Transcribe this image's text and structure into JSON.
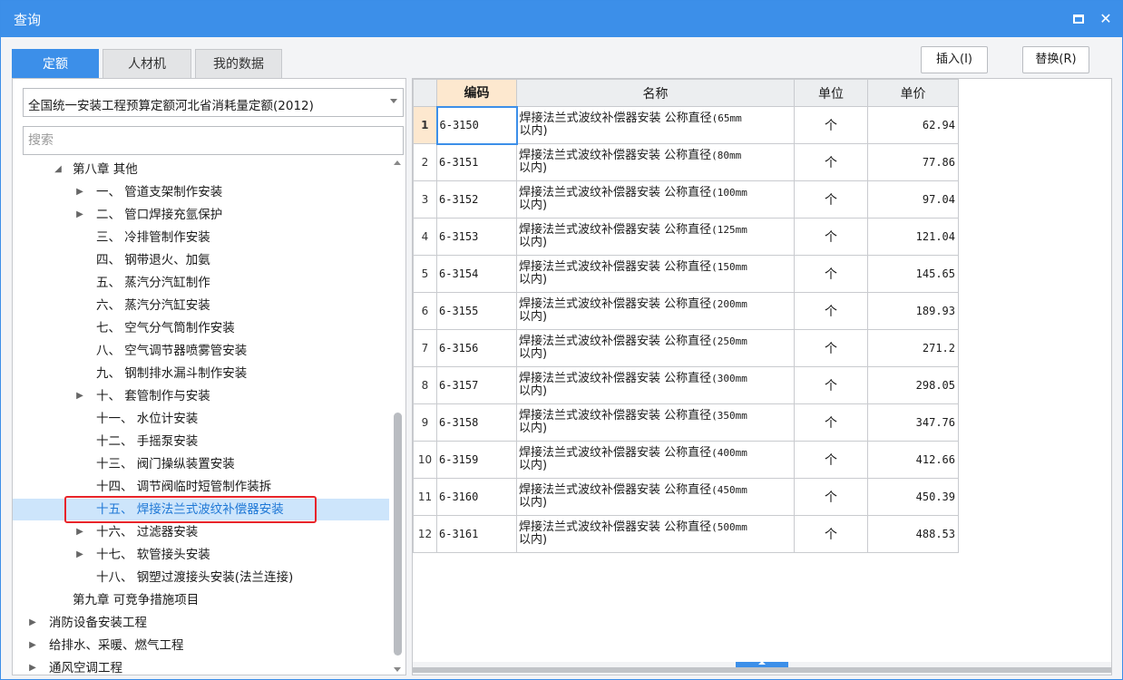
{
  "window": {
    "title": "查询",
    "close": "✕"
  },
  "tabs": [
    {
      "label": "定额",
      "active": true
    },
    {
      "label": "人材机",
      "active": false
    },
    {
      "label": "我的数据",
      "active": false
    }
  ],
  "actions": {
    "insert": "插入(I)",
    "replace": "替换(R)"
  },
  "library_select": {
    "value": "全国统一安装工程预算定额河北省消耗量定额(2012)"
  },
  "search": {
    "placeholder": "搜索"
  },
  "tree": [
    {
      "label": "第八章 其他",
      "toggle": "◢",
      "level": 1
    },
    {
      "label": "一、 管道支架制作安装",
      "toggle": "▶",
      "level": 2
    },
    {
      "label": "二、 管口焊接充氩保护",
      "toggle": "▶",
      "level": 2
    },
    {
      "label": "三、 冷排管制作安装",
      "toggle": "",
      "level": 2
    },
    {
      "label": "四、 钢带退火、加氨",
      "toggle": "",
      "level": 2
    },
    {
      "label": "五、 蒸汽分汽缸制作",
      "toggle": "",
      "level": 2
    },
    {
      "label": "六、 蒸汽分汽缸安装",
      "toggle": "",
      "level": 2
    },
    {
      "label": "七、 空气分气筒制作安装",
      "toggle": "",
      "level": 2
    },
    {
      "label": "八、 空气调节器喷雾管安装",
      "toggle": "",
      "level": 2
    },
    {
      "label": "九、 钢制排水漏斗制作安装",
      "toggle": "",
      "level": 2
    },
    {
      "label": "十、 套管制作与安装",
      "toggle": "▶",
      "level": 2
    },
    {
      "label": "十一、 水位计安装",
      "toggle": "",
      "level": 2
    },
    {
      "label": "十二、 手摇泵安装",
      "toggle": "",
      "level": 2
    },
    {
      "label": "十三、 阀门操纵装置安装",
      "toggle": "",
      "level": 2
    },
    {
      "label": "十四、 调节阀临时短管制作装拆",
      "toggle": "",
      "level": 2
    },
    {
      "label": "十五、 焊接法兰式波纹补偿器安装",
      "toggle": "",
      "level": 2,
      "selected": true
    },
    {
      "label": "十六、 过滤器安装",
      "toggle": "▶",
      "level": 2
    },
    {
      "label": "十七、 软管接头安装",
      "toggle": "▶",
      "level": 2
    },
    {
      "label": "十八、 钢塑过渡接头安装(法兰连接)",
      "toggle": "",
      "level": 2
    },
    {
      "label": "第九章 可竞争措施项目",
      "toggle": "",
      "level": 1
    },
    {
      "label": "消防设备安装工程",
      "toggle": "▶",
      "level": 0
    },
    {
      "label": "给排水、采暖、燃气工程",
      "toggle": "▶",
      "level": 0
    },
    {
      "label": "通风空调工程",
      "toggle": "▶",
      "level": 0
    }
  ],
  "grid": {
    "headers": {
      "code": "编码",
      "name": "名称",
      "unit": "单位",
      "price": "单价"
    },
    "rows": [
      {
        "no": "1",
        "code": "6-3150",
        "name_a": "焊接法兰式波纹补偿器安装 公称直径",
        "name_b": "(65mm",
        "name_c": "以内)",
        "unit": "个",
        "price": "62.94"
      },
      {
        "no": "2",
        "code": "6-3151",
        "name_a": "焊接法兰式波纹补偿器安装 公称直径",
        "name_b": "(80mm",
        "name_c": "以内)",
        "unit": "个",
        "price": "77.86"
      },
      {
        "no": "3",
        "code": "6-3152",
        "name_a": "焊接法兰式波纹补偿器安装 公称直径",
        "name_b": "(100mm",
        "name_c": "以内)",
        "unit": "个",
        "price": "97.04"
      },
      {
        "no": "4",
        "code": "6-3153",
        "name_a": "焊接法兰式波纹补偿器安装 公称直径",
        "name_b": "(125mm",
        "name_c": "以内)",
        "unit": "个",
        "price": "121.04"
      },
      {
        "no": "5",
        "code": "6-3154",
        "name_a": "焊接法兰式波纹补偿器安装 公称直径",
        "name_b": "(150mm",
        "name_c": "以内)",
        "unit": "个",
        "price": "145.65"
      },
      {
        "no": "6",
        "code": "6-3155",
        "name_a": "焊接法兰式波纹补偿器安装 公称直径",
        "name_b": "(200mm",
        "name_c": "以内)",
        "unit": "个",
        "price": "189.93"
      },
      {
        "no": "7",
        "code": "6-3156",
        "name_a": "焊接法兰式波纹补偿器安装 公称直径",
        "name_b": "(250mm",
        "name_c": "以内)",
        "unit": "个",
        "price": "271.2"
      },
      {
        "no": "8",
        "code": "6-3157",
        "name_a": "焊接法兰式波纹补偿器安装 公称直径",
        "name_b": "(300mm",
        "name_c": "以内)",
        "unit": "个",
        "price": "298.05"
      },
      {
        "no": "9",
        "code": "6-3158",
        "name_a": "焊接法兰式波纹补偿器安装 公称直径",
        "name_b": "(350mm",
        "name_c": "以内)",
        "unit": "个",
        "price": "347.76"
      },
      {
        "no": "10",
        "code": "6-3159",
        "name_a": "焊接法兰式波纹补偿器安装 公称直径",
        "name_b": "(400mm",
        "name_c": "以内)",
        "unit": "个",
        "price": "412.66"
      },
      {
        "no": "11",
        "code": "6-3160",
        "name_a": "焊接法兰式波纹补偿器安装 公称直径",
        "name_b": "(450mm",
        "name_c": "以内)",
        "unit": "个",
        "price": "450.39"
      },
      {
        "no": "12",
        "code": "6-3161",
        "name_a": "焊接法兰式波纹补偿器安装 公称直径",
        "name_b": "(500mm",
        "name_c": "以内)",
        "unit": "个",
        "price": "488.53"
      }
    ]
  }
}
